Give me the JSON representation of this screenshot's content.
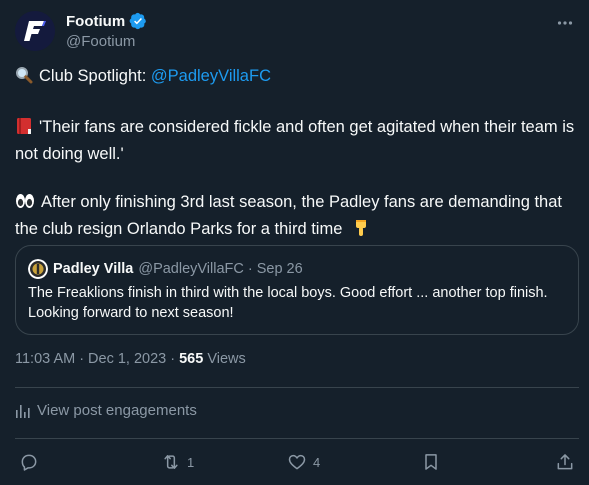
{
  "author": {
    "display_name": "Footium",
    "handle": "@Footium",
    "avatar_letter": "F",
    "verified": true,
    "brand_color": "#4b5cf0"
  },
  "post": {
    "line1_prefix": "Club Spotlight: ",
    "line1_mention": "@PadleyVillaFC",
    "line1_icon": "magnifier-emoji",
    "para2": "'Their fans are considered fickle and often get agitated when their team is not doing well.'",
    "para2_icon": "red-book-emoji",
    "para3": "After only finishing 3rd last season, the Padley fans are demanding that the club resign Orlando Parks for a third time",
    "para3_icon": "eyes-emoji",
    "para3_suffix_icon": "pointing-down-emoji"
  },
  "quote": {
    "name": "Padley Villa",
    "handle": "@PadleyVillaFC",
    "dot": "·",
    "date": "Sep 26",
    "text": "The Freaklions finish in third with the local boys. Good effort ... another top finish.  Looking forward to next season!"
  },
  "meta": {
    "time": "11:03 AM",
    "sep1": "·",
    "date": "Dec 1, 2023",
    "sep2": "·",
    "views_count": "565",
    "views_label": " Views"
  },
  "engagements_label": "View post engagements",
  "actions": {
    "reply_count": "",
    "repost_count": "1",
    "like_count": "4"
  },
  "colors": {
    "background": "#15202b",
    "text": "#f7f9f9",
    "secondary": "#8b98a5",
    "accent": "#1d9bf0",
    "border": "#38444d"
  }
}
